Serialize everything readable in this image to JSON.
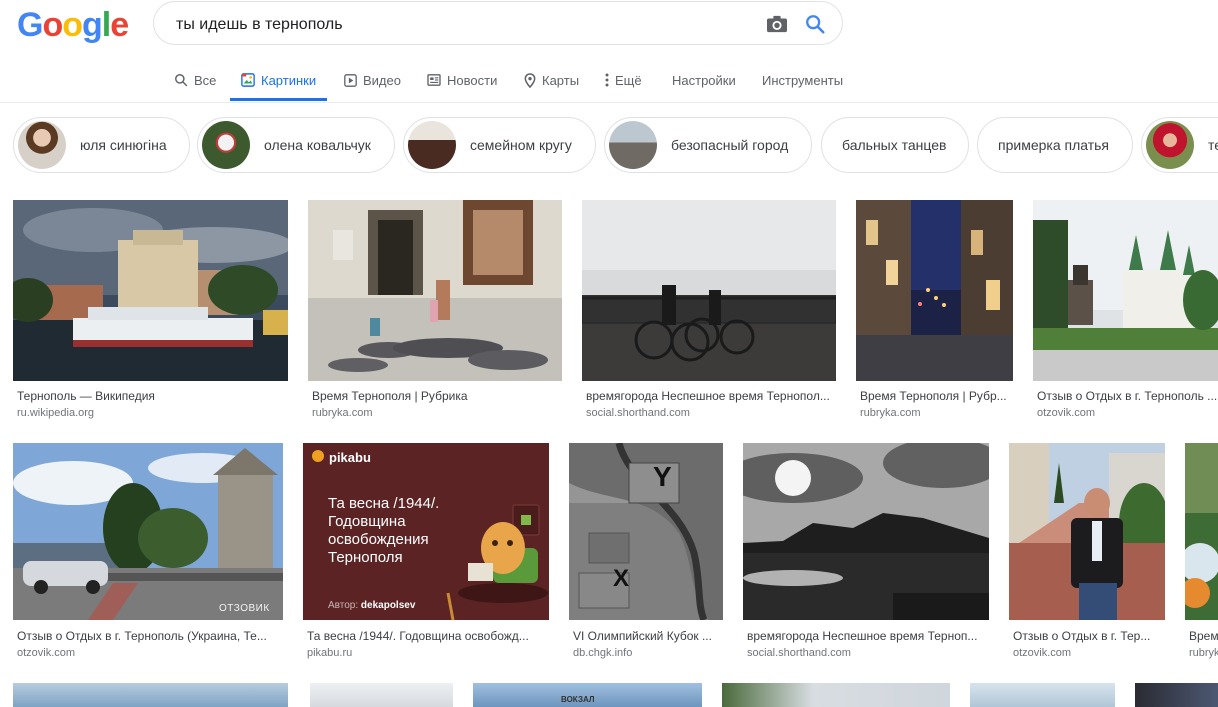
{
  "logo": {
    "letters": [
      "G",
      "o",
      "o",
      "g",
      "l",
      "e"
    ],
    "colors": [
      "#4285f4",
      "#ea4335",
      "#fbbc05",
      "#4285f4",
      "#34a853",
      "#ea4335"
    ]
  },
  "search": {
    "query": "ты идешь в тернополь",
    "camera_icon": "camera-icon",
    "search_icon": "search-icon"
  },
  "tabs": [
    {
      "label": "Все",
      "icon": "search-icon"
    },
    {
      "label": "Картинки",
      "icon": "images-icon",
      "active": true
    },
    {
      "label": "Видео",
      "icon": "video-icon"
    },
    {
      "label": "Новости",
      "icon": "news-icon"
    },
    {
      "label": "Карты",
      "icon": "map-pin-icon"
    },
    {
      "label": "Ещё",
      "icon": "more-vert-icon"
    },
    {
      "label": "Настройки"
    },
    {
      "label": "Инструменты"
    }
  ],
  "chips": [
    {
      "label": "юля синюгіна"
    },
    {
      "label": "олена ковальчук"
    },
    {
      "label": "семейном кругу"
    },
    {
      "label": "безопасный город"
    },
    {
      "label": "бальных танцев"
    },
    {
      "label": "примерка платья"
    },
    {
      "label": "те"
    }
  ],
  "results_row1": [
    {
      "title": "Тернополь — Википедия",
      "source": "ru.wikipedia.org"
    },
    {
      "title": "Время Тернополя | Рубрика",
      "source": "rubryka.com"
    },
    {
      "title": "времягорода Неспешное время Тернопол...",
      "source": "social.shorthand.com"
    },
    {
      "title": "Время Тернополя | Рубр...",
      "source": "rubryka.com"
    },
    {
      "title": "Отзыв о Отдых в г. Тернополь ...",
      "source": "otzovik.com"
    }
  ],
  "results_row2": [
    {
      "title": "Отзыв о Отдых в г. Тернополь (Украина, Те...",
      "source": "otzovik.com",
      "watermark": "ОТЗОВИК"
    },
    {
      "title": "Та весна /1944/. Годовщина освобожд...",
      "source": "pikabu.ru",
      "pikabu": {
        "brand": "pikabu",
        "text": "Та весна /1944/. Годовщина освобождения Тернополя",
        "author_label": "Автор:",
        "author": "dekapolsev"
      }
    },
    {
      "title": "VI Олимпийский Кубок ...",
      "source": "db.chgk.info",
      "map_marks": [
        "Y",
        "X"
      ]
    },
    {
      "title": "времягорода Неспешное время Терноп...",
      "source": "social.shorthand.com"
    },
    {
      "title": "Отзыв о Отдых в г. Тер...",
      "source": "otzovik.com"
    },
    {
      "title": "Время",
      "source": "rubryk"
    }
  ],
  "row3_sign": "ВОКЗАЛ"
}
